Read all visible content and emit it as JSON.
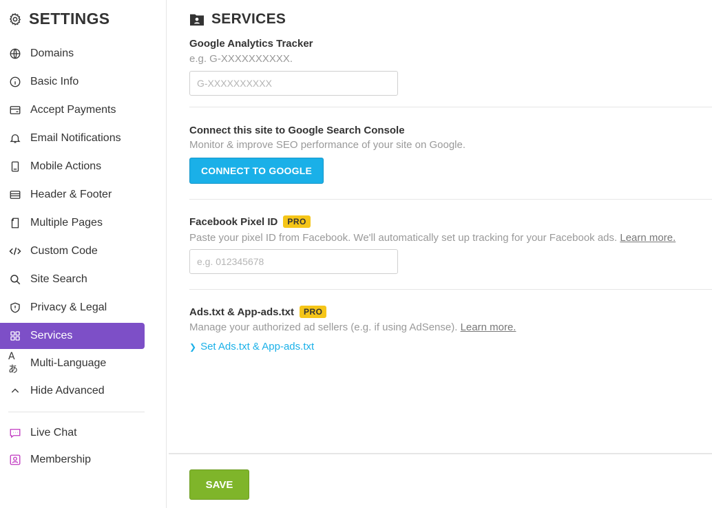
{
  "sidebar": {
    "title": "SETTINGS",
    "title_icon": "gear-icon",
    "items": [
      {
        "label": "Domains",
        "icon": "globe-icon"
      },
      {
        "label": "Basic Info",
        "icon": "info-icon"
      },
      {
        "label": "Accept Payments",
        "icon": "payment-card-icon"
      },
      {
        "label": "Email Notifications",
        "icon": "bell-icon"
      },
      {
        "label": "Mobile Actions",
        "icon": "mobile-icon"
      },
      {
        "label": "Header & Footer",
        "icon": "layout-icon"
      },
      {
        "label": "Multiple Pages",
        "icon": "pages-icon"
      },
      {
        "label": "Custom Code",
        "icon": "code-icon"
      },
      {
        "label": "Site Search",
        "icon": "search-icon"
      },
      {
        "label": "Privacy & Legal",
        "icon": "shield-icon"
      },
      {
        "label": "Services",
        "icon": "grid-icon",
        "active": true
      },
      {
        "label": "Multi-Language",
        "icon": "translate-icon"
      },
      {
        "label": "Hide Advanced",
        "icon": "chevron-up-icon"
      },
      {
        "label": "Live Chat",
        "icon": "chat-icon"
      },
      {
        "label": "Membership",
        "icon": "member-icon"
      }
    ],
    "colors": {
      "active_bg": "#7d4fc7",
      "addon_icon": "#c13ac1"
    }
  },
  "main": {
    "title": "SERVICES",
    "title_icon": "folder-user-icon",
    "google_analytics": {
      "title": "Google Analytics Tracker",
      "desc": "e.g. G-XXXXXXXXXX.",
      "placeholder": "G-XXXXXXXXXX"
    },
    "search_console": {
      "title": "Connect this site to Google Search Console",
      "desc": "Monitor & improve SEO performance of your site on Google.",
      "button": "CONNECT TO GOOGLE"
    },
    "facebook_pixel": {
      "title": "Facebook Pixel ID",
      "badge": "PRO",
      "desc": "Paste your pixel ID from Facebook. We'll automatically set up tracking for your Facebook ads.",
      "learn_more": "Learn more.",
      "placeholder": "e.g. 012345678"
    },
    "ads_txt": {
      "title": "Ads.txt & App-ads.txt",
      "badge": "PRO",
      "desc": "Manage your authorized ad sellers (e.g. if using AdSense).",
      "learn_more": "Learn more.",
      "link": "Set Ads.txt & App-ads.txt"
    }
  },
  "footer": {
    "save_label": "SAVE"
  },
  "colors": {
    "connect_button": "#1ab0e8",
    "save_button": "#7fb52a",
    "pro_badge": "#f5c518",
    "link": "#1ab0e8"
  }
}
